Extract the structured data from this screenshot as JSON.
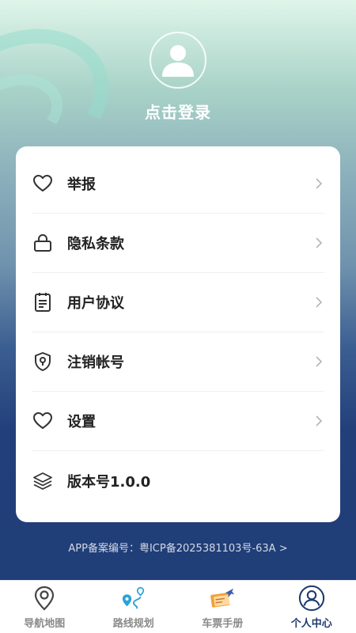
{
  "header": {
    "login_text": "点击登录"
  },
  "menu": {
    "items": [
      {
        "label": "举报",
        "icon": "heart-icon",
        "has_arrow": true
      },
      {
        "label": "隐私条款",
        "icon": "lock-icon",
        "has_arrow": true
      },
      {
        "label": "用户协议",
        "icon": "clipboard-icon",
        "has_arrow": true
      },
      {
        "label": "注销帐号",
        "icon": "shield-icon",
        "has_arrow": true
      },
      {
        "label": "设置",
        "icon": "heart-icon",
        "has_arrow": true
      },
      {
        "label": "版本号1.0.0",
        "icon": "layers-icon",
        "has_arrow": false
      }
    ]
  },
  "footer": {
    "icp_text": "APP备案编号：粤ICP备2025381103号-63A >"
  },
  "tabbar": {
    "tabs": [
      {
        "label": "导航地图",
        "icon": "map-pin-icon",
        "active": false
      },
      {
        "label": "路线规划",
        "icon": "route-icon",
        "active": false
      },
      {
        "label": "车票手册",
        "icon": "ticket-plane-icon",
        "active": false
      },
      {
        "label": "个人中心",
        "icon": "user-circle-icon",
        "active": true
      }
    ]
  },
  "colors": {
    "active_tab": "#1e3a6e",
    "inactive_tab": "#8a8a8a",
    "route_accent": "#2aa3d8",
    "ticket_accent": "#f0a23a"
  }
}
